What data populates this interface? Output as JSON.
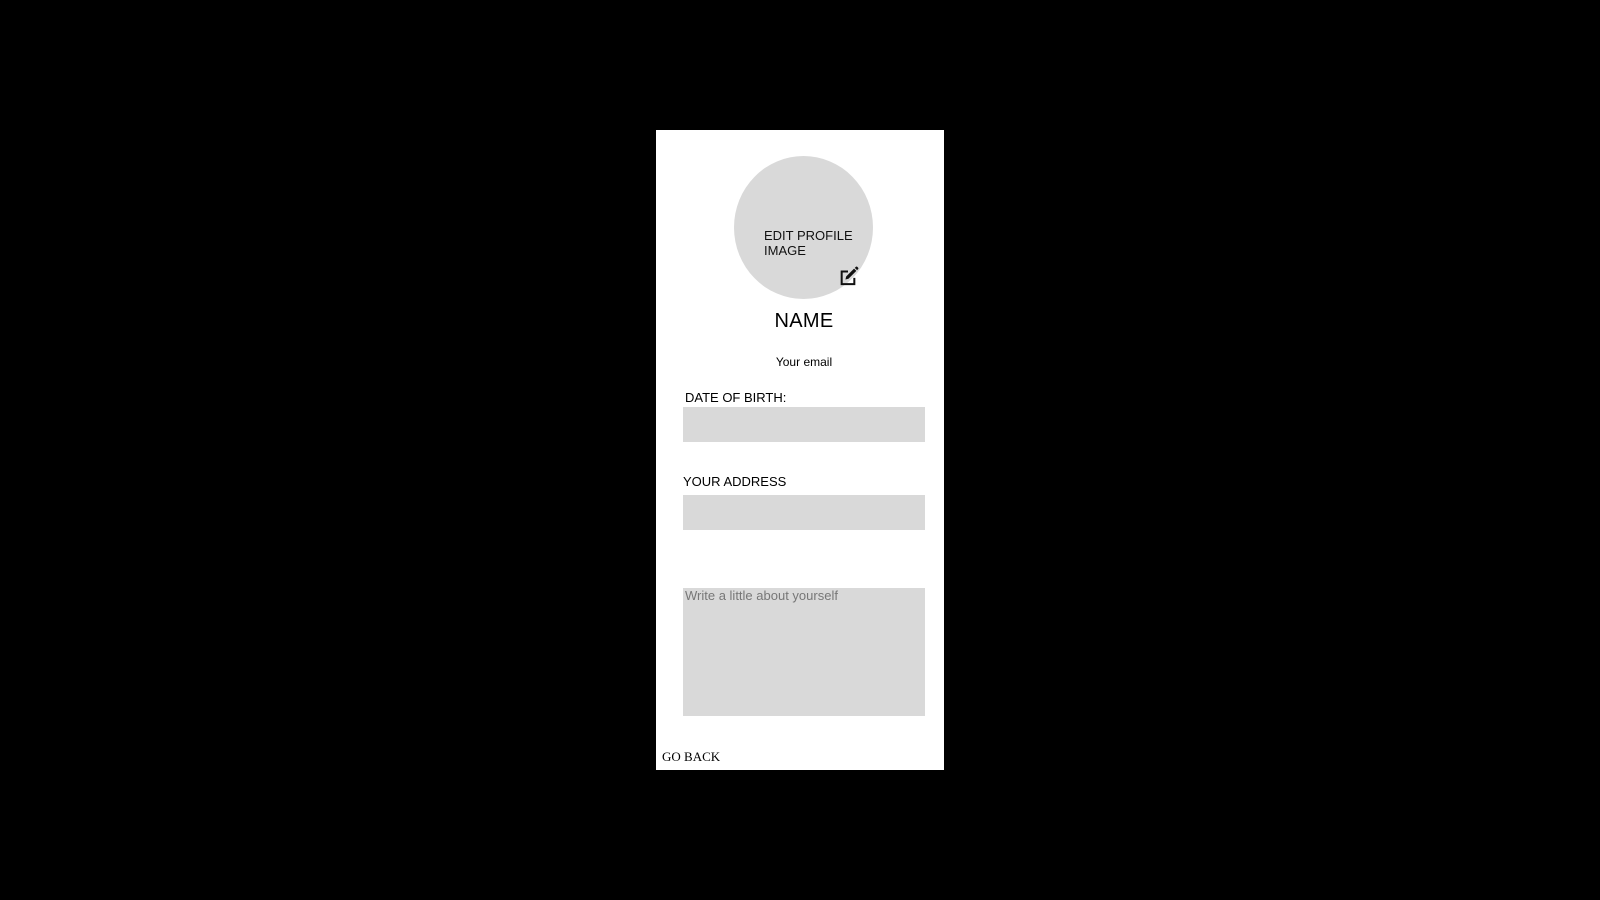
{
  "profile": {
    "avatar_label": "EDIT PROFILE\nIMAGE",
    "edit_icon": "edit-pencil-square-icon",
    "name": "NAME",
    "email": "Your email"
  },
  "form": {
    "dob_label": "DATE OF BIRTH:",
    "dob_value": "",
    "address_label": "YOUR ADDRESS",
    "address_value": "",
    "about_placeholder": "Write a little about yourself",
    "about_value": ""
  },
  "footer": {
    "back_label": "GO BACK"
  },
  "colors": {
    "background": "#000000",
    "panel": "#ffffff",
    "field_fill": "#d9d9d9"
  }
}
